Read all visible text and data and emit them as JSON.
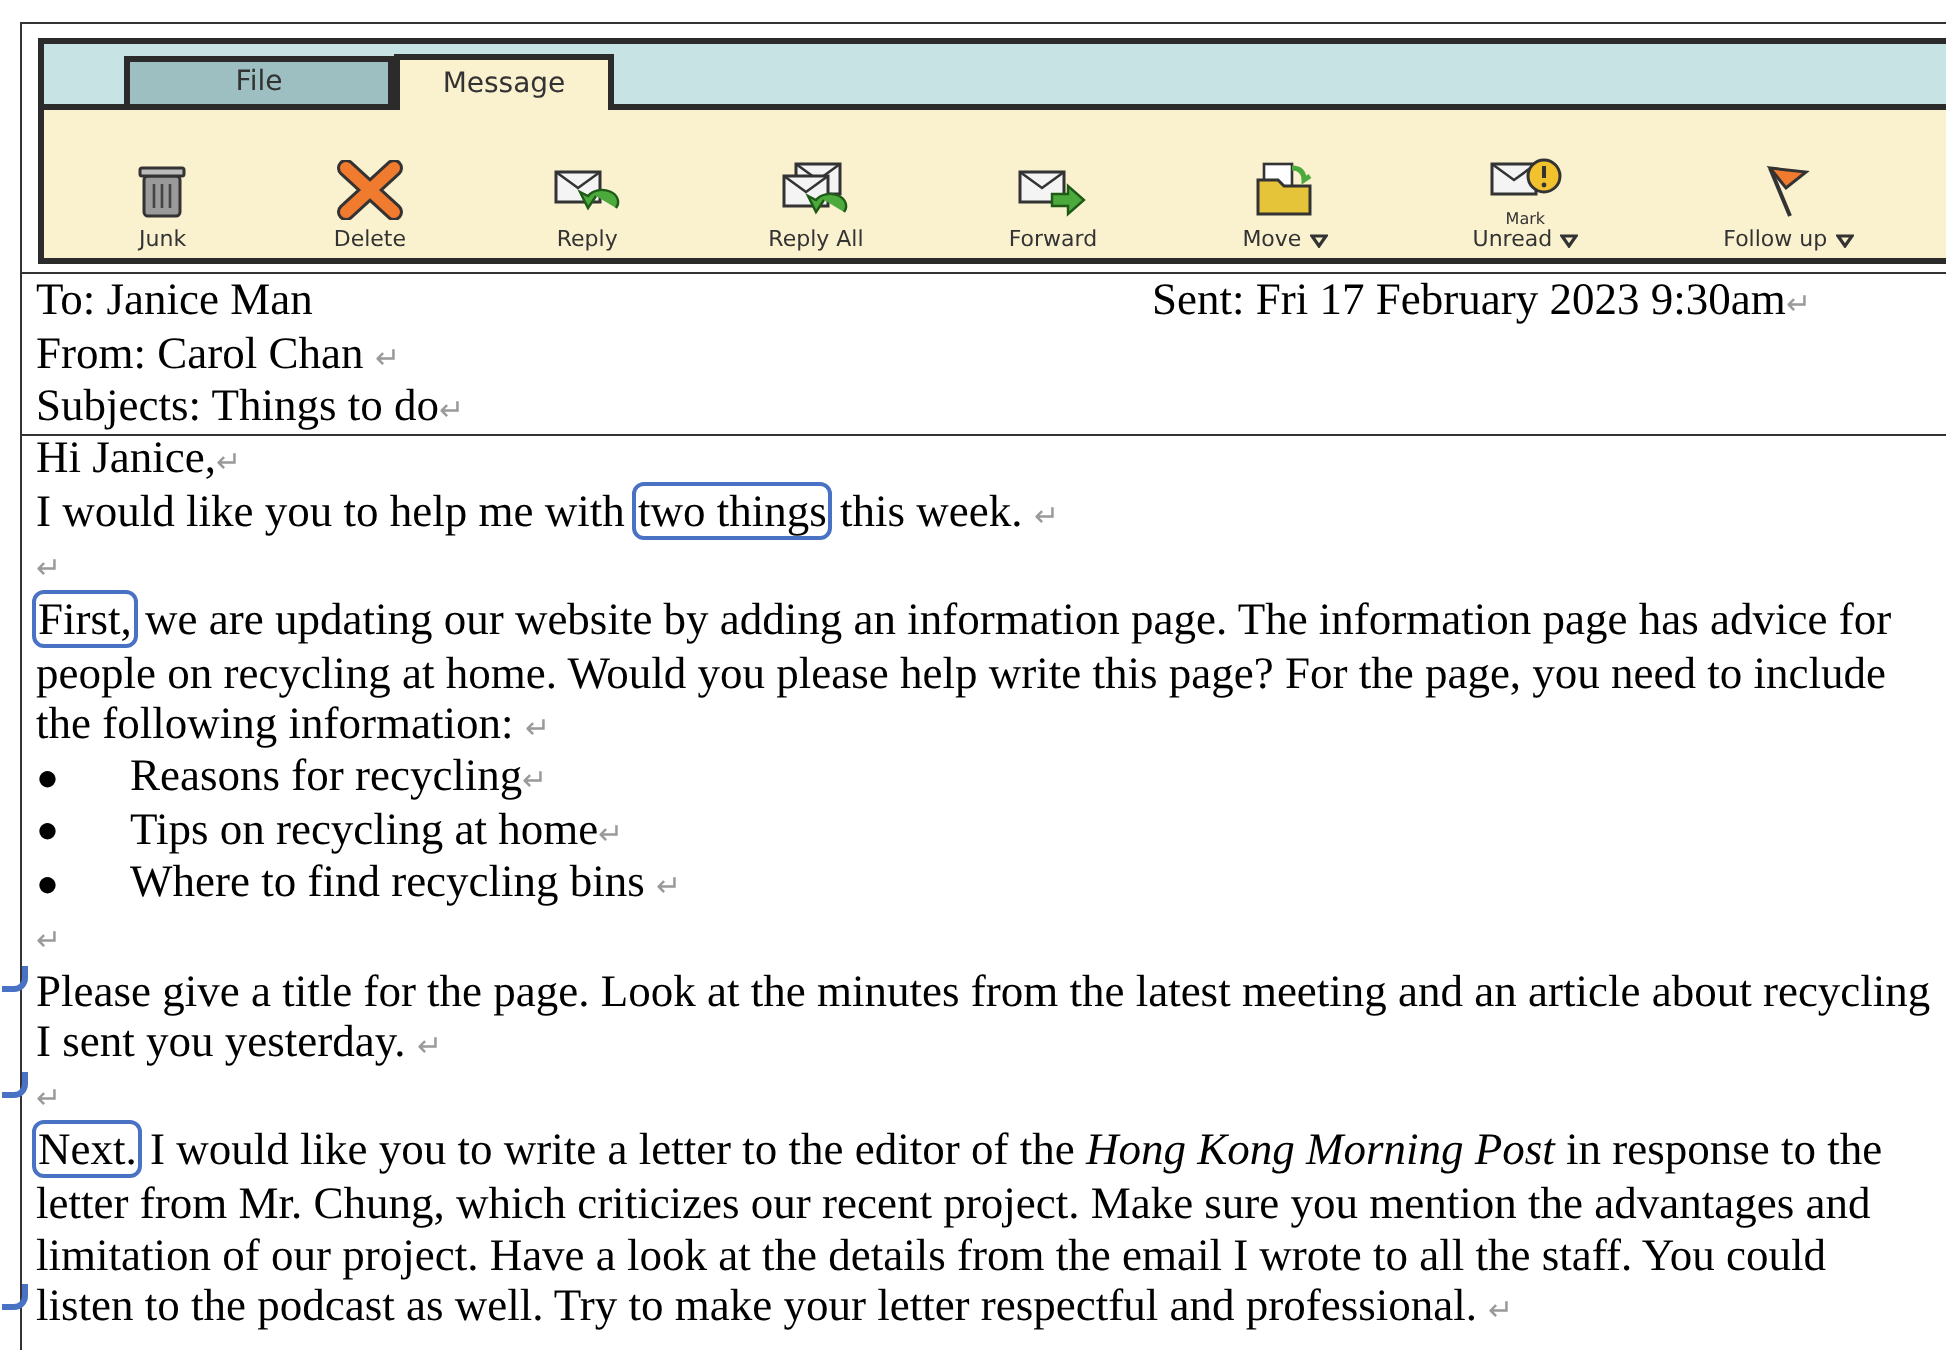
{
  "ribbon": {
    "tabs": [
      {
        "label": "File",
        "selected": false
      },
      {
        "label": "Message",
        "selected": true
      }
    ],
    "buttons": [
      {
        "kind": "junk",
        "label": "Junk",
        "dropdown": false
      },
      {
        "kind": "delete",
        "label": "Delete",
        "dropdown": false
      },
      {
        "kind": "reply",
        "label": "Reply",
        "dropdown": false
      },
      {
        "kind": "reply_all",
        "label": "Reply All",
        "dropdown": false
      },
      {
        "kind": "forward",
        "label": "Forward",
        "dropdown": false
      },
      {
        "kind": "move",
        "label": "Move",
        "dropdown": true
      },
      {
        "kind": "mark_unread",
        "label_top": "Mark",
        "label": "Unread",
        "dropdown": true
      },
      {
        "kind": "follow_up",
        "label": "Follow up",
        "dropdown": true
      }
    ]
  },
  "header": {
    "to": "To: Janice Man",
    "sent": "Sent: Fri 17 February 2023 9:30am",
    "from": "From: Carol Chan",
    "subject": "Subjects: Things to do",
    "return_mark": "↵"
  },
  "body": [
    {
      "mark": false,
      "segments": [
        {
          "kind": "text",
          "text": "Hi Janice,"
        },
        {
          "kind": "return",
          "text": "↵"
        }
      ]
    },
    {
      "mark": false,
      "segments": [
        {
          "kind": "text",
          "text": "I would like you to help me with "
        },
        {
          "kind": "boxed",
          "text": "two things"
        },
        {
          "kind": "text",
          "text": " this week. "
        },
        {
          "kind": "return",
          "text": "↵"
        }
      ]
    },
    {
      "mark": false,
      "segments": [
        {
          "kind": "return",
          "text": "↵"
        }
      ]
    },
    {
      "mark": false,
      "segments": [
        {
          "kind": "boxed",
          "text": "First,"
        },
        {
          "kind": "text",
          "text": " we are updating our website by adding an information page. The information page has advice for"
        }
      ]
    },
    {
      "mark": false,
      "segments": [
        {
          "kind": "text",
          "text": "people on recycling at home. Would you please help write this page? For the page, you need to include"
        }
      ]
    },
    {
      "mark": false,
      "segments": [
        {
          "kind": "text",
          "text": "the following information: "
        },
        {
          "kind": "return",
          "text": "↵"
        }
      ]
    },
    {
      "mark": false,
      "bullet": "●",
      "segments": [
        {
          "kind": "text",
          "text": "Reasons for recycling"
        },
        {
          "kind": "return",
          "text": "↵"
        }
      ]
    },
    {
      "mark": false,
      "bullet": "●",
      "segments": [
        {
          "kind": "text",
          "text": "Tips on recycling at home"
        },
        {
          "kind": "return",
          "text": "↵"
        }
      ]
    },
    {
      "mark": false,
      "bullet": "●",
      "segments": [
        {
          "kind": "text",
          "text": "Where to find recycling bins "
        },
        {
          "kind": "return",
          "text": "↵"
        }
      ]
    },
    {
      "mark": false,
      "segments": [
        {
          "kind": "return",
          "text": "↵"
        }
      ]
    },
    {
      "mark": true,
      "segments": [
        {
          "kind": "text",
          "text": "Please give a title for the page. Look at the minutes from the latest meeting and an article about recycling"
        }
      ]
    },
    {
      "mark": false,
      "segments": [
        {
          "kind": "text",
          "text": "I sent you yesterday. "
        },
        {
          "kind": "return",
          "text": "↵"
        }
      ]
    },
    {
      "mark": true,
      "segments": [
        {
          "kind": "return",
          "text": "↵"
        }
      ]
    },
    {
      "mark": false,
      "segments": [
        {
          "kind": "boxed",
          "text": "Next."
        },
        {
          "kind": "text",
          "text": " I would like you to write a letter to the editor of the "
        },
        {
          "kind": "italic",
          "text": "Hong Kong Morning Post"
        },
        {
          "kind": "text",
          "text": " in response to the"
        }
      ]
    },
    {
      "mark": false,
      "segments": [
        {
          "kind": "text",
          "text": "letter from Mr. Chung, which criticizes our recent project. Make sure you mention the advantages and"
        }
      ]
    },
    {
      "mark": false,
      "segments": [
        {
          "kind": "text",
          "text": "limitation of our project. Have a look at the details from the email I wrote to all the staff. You could"
        }
      ]
    },
    {
      "mark": true,
      "segments": [
        {
          "kind": "text",
          "text": "listen to the podcast as well. Try to make your letter respectful and professional. "
        },
        {
          "kind": "return",
          "text": "↵"
        }
      ]
    }
  ]
}
